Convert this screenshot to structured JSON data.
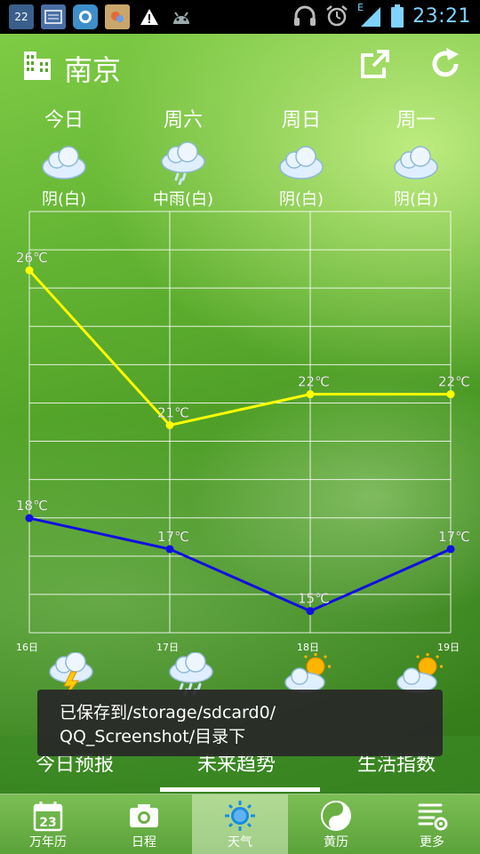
{
  "status_bar": {
    "time": "23:21",
    "network": "E",
    "icons": [
      "calendar-22-icon",
      "news-icon",
      "qq-icon",
      "photo-icon",
      "warning-icon",
      "android-icon",
      "headphones-icon",
      "alarm-icon",
      "signal-icon",
      "battery-icon"
    ],
    "calendar_day": "22"
  },
  "header": {
    "city": "南京"
  },
  "forecast": [
    {
      "day": "今日",
      "condition": "阴(白)",
      "icon": "cloudy-icon"
    },
    {
      "day": "周六",
      "condition": "中雨(白)",
      "icon": "rain-icon"
    },
    {
      "day": "周日",
      "condition": "阴(白)",
      "icon": "cloudy-icon"
    },
    {
      "day": "周一",
      "condition": "阴(白)",
      "icon": "cloudy-icon"
    }
  ],
  "chart_data": {
    "type": "line",
    "categories": [
      "16日",
      "17日",
      "18日",
      "19日"
    ],
    "series": [
      {
        "values": [
          26,
          21,
          22,
          22
        ],
        "labels": [
          "26℃",
          "21℃",
          "22℃",
          "22℃"
        ],
        "color": "#ffff00"
      },
      {
        "values": [
          18,
          17,
          15,
          17
        ],
        "labels": [
          "18℃",
          "17℃",
          "15℃",
          "17℃"
        ],
        "color": "#1010e0"
      }
    ],
    "ylim": [
      14.3,
      27.9
    ],
    "grid": true
  },
  "trend_icons": [
    "thunderstorm-icon",
    "rain-icon",
    "partly-sunny-icon",
    "partly-sunny-icon"
  ],
  "toast": {
    "line1": "已保存到/storage/sdcard0/",
    "line2": "QQ_Screenshot/目录下"
  },
  "sub_tabs": [
    {
      "label": "今日预报"
    },
    {
      "label": "未来趋势",
      "active": true
    },
    {
      "label": "生活指数"
    }
  ],
  "bottom_nav": [
    {
      "label": "万年历",
      "icon": "calendar-icon",
      "calendar_day": "23"
    },
    {
      "label": "日程",
      "icon": "camera-icon"
    },
    {
      "label": "天气",
      "icon": "sun-icon",
      "active": true
    },
    {
      "label": "黄历",
      "icon": "yin-yang-icon"
    },
    {
      "label": "更多",
      "icon": "settings-list-icon"
    }
  ]
}
